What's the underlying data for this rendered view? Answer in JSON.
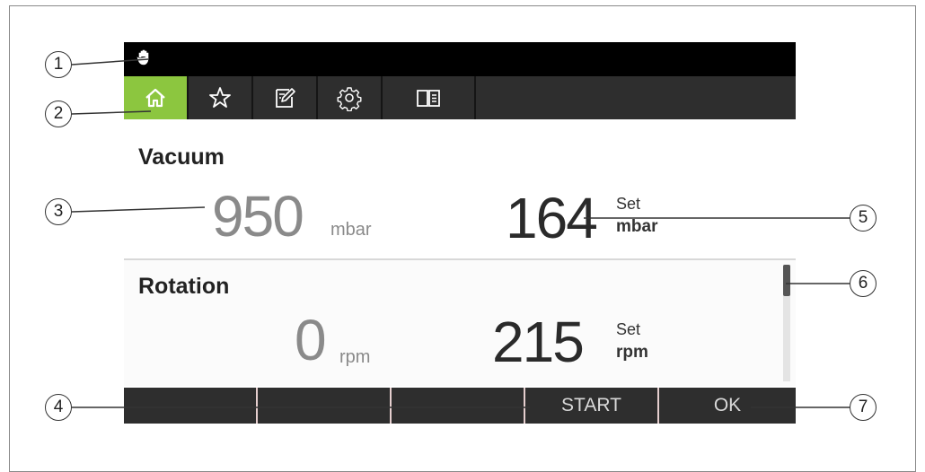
{
  "tabs": [
    {
      "icon": "home-icon",
      "active": true
    },
    {
      "icon": "star-icon",
      "active": false
    },
    {
      "icon": "edit-icon",
      "active": false
    },
    {
      "icon": "gear-icon",
      "active": false
    },
    {
      "icon": "book-icon",
      "active": false
    }
  ],
  "vacuum": {
    "label": "Vacuum",
    "actual": "950",
    "actual_unit": "mbar",
    "set_value": "164",
    "set_label": "Set",
    "set_unit": "mbar"
  },
  "rotation": {
    "label": "Rotation",
    "actual": "0",
    "actual_unit": "rpm",
    "set_value": "215",
    "set_label": "Set",
    "set_unit": "rpm"
  },
  "softkeys": [
    "",
    "",
    "",
    "START",
    "OK"
  ],
  "callouts": [
    "1",
    "2",
    "3",
    "4",
    "5",
    "6",
    "7"
  ],
  "colors": {
    "active_tab": "#8cc63f",
    "bar": "#2e2e2e",
    "status_bar": "#000000",
    "actual_value": "#8a8a8a"
  }
}
